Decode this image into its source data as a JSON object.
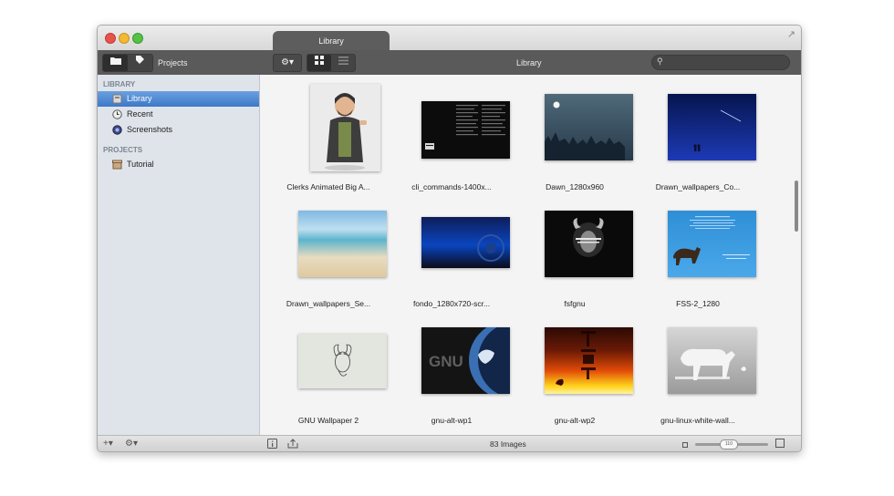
{
  "window": {
    "tab_title": "Library"
  },
  "toolbar": {
    "left_title": "Projects",
    "center_title": "Library",
    "search_placeholder": ""
  },
  "sidebar": {
    "library_header": "LIBRARY",
    "library_items": [
      {
        "label": "Library",
        "icon": "library-icon",
        "selected": true
      },
      {
        "label": "Recent",
        "icon": "clock-icon",
        "selected": false
      },
      {
        "label": "Screenshots",
        "icon": "camera-icon",
        "selected": false
      }
    ],
    "projects_header": "PROJECTS",
    "project_items": [
      {
        "label": "Tutorial",
        "icon": "box-icon"
      }
    ]
  },
  "grid": {
    "items": [
      {
        "caption": "Clerks Animated Big A...",
        "kind": "portrait"
      },
      {
        "caption": "cli_commands-1400x...",
        "kind": "terminal"
      },
      {
        "caption": "Dawn_1280x960",
        "kind": "dawn"
      },
      {
        "caption": "Drawn_wallpapers_Co...",
        "kind": "night"
      },
      {
        "caption": "Drawn_wallpapers_Se...",
        "kind": "beach"
      },
      {
        "caption": "fondo_1280x720-scr...",
        "kind": "blue"
      },
      {
        "caption": "fsfgnu",
        "kind": "gnu-dark"
      },
      {
        "caption": "FSS-2_1280",
        "kind": "fss"
      },
      {
        "caption": "GNU Wallpaper 2",
        "kind": "gnu-light"
      },
      {
        "caption": "gnu-alt-wp1",
        "kind": "gnu-alt1"
      },
      {
        "caption": "gnu-alt-wp2",
        "kind": "gnu-alt2"
      },
      {
        "caption": "gnu-linux-white-wall...",
        "kind": "white-wall"
      }
    ]
  },
  "status": {
    "count": "83 Images",
    "zoom_label": "110",
    "zoom_fraction": 0.45
  },
  "colors": {
    "selection": "#3d78c8",
    "toolbar": "#5a5a5a",
    "sidebar": "#dfe4ea"
  }
}
